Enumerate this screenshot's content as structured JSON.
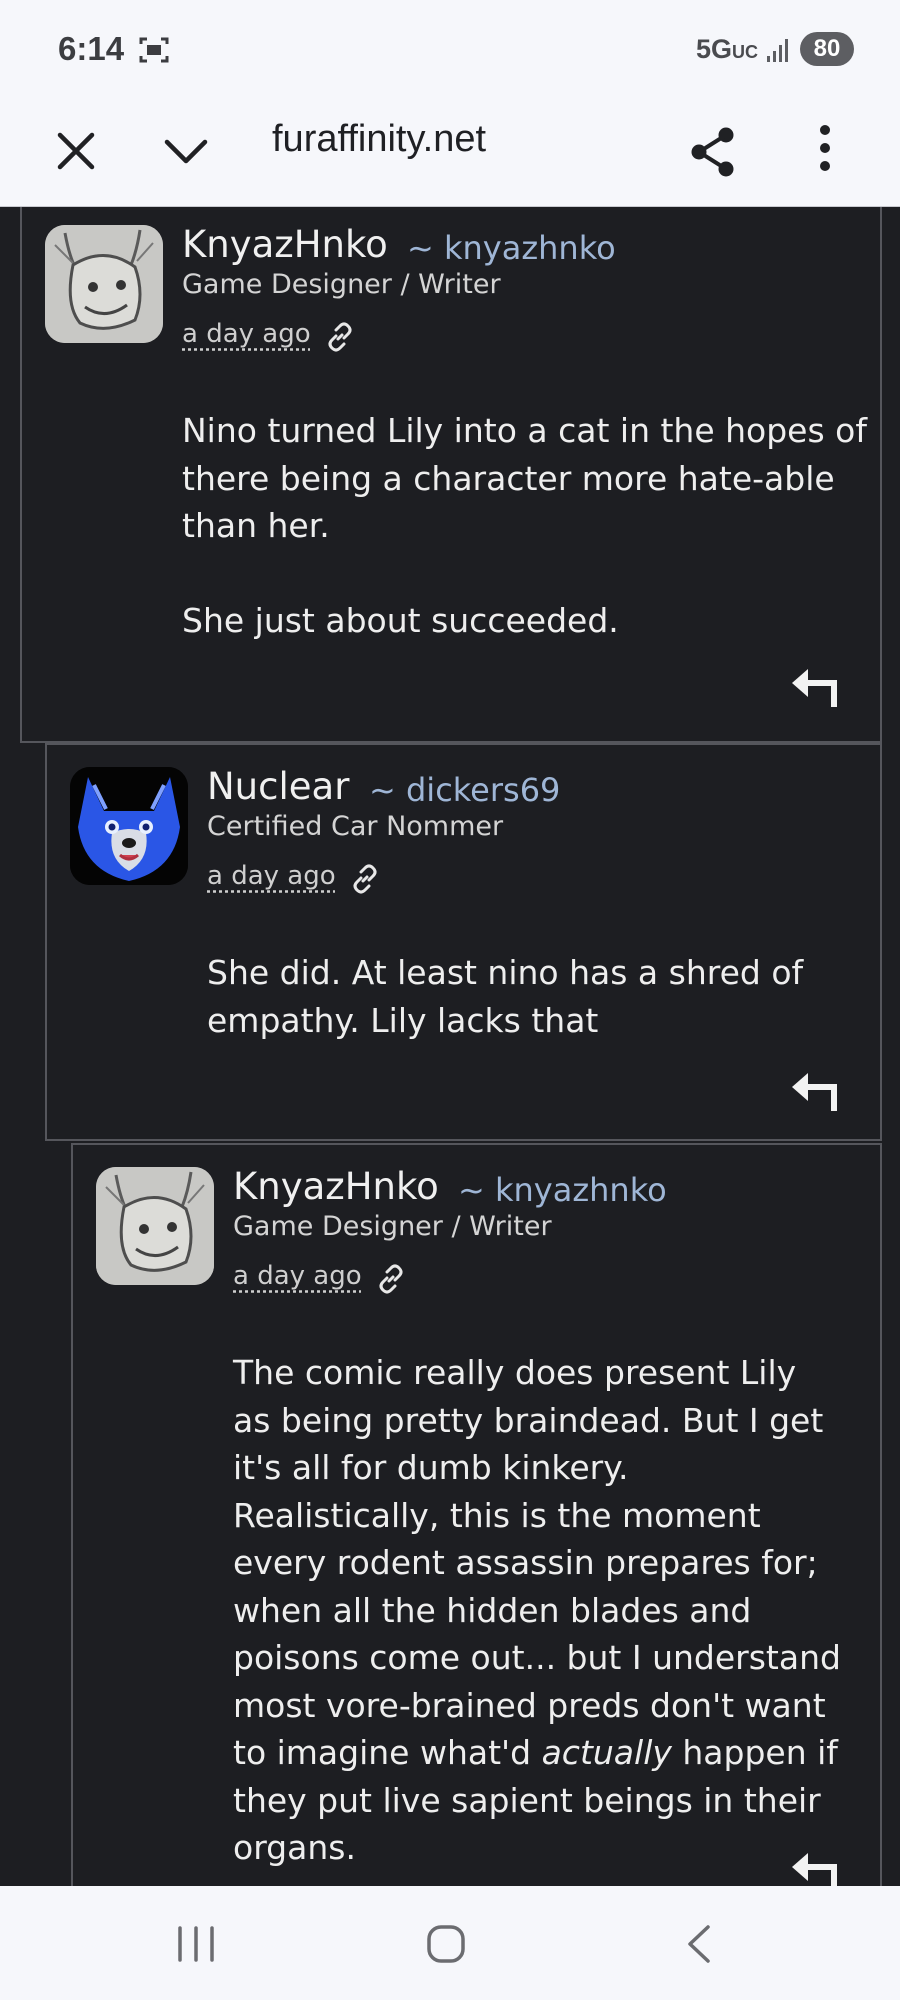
{
  "status_bar": {
    "time": "6:14",
    "network": "5G",
    "network_suffix": "UC",
    "battery": "80"
  },
  "browser": {
    "url": "furaffinity.net"
  },
  "comments": [
    {
      "username": "KnyazHnko",
      "handle": "~ knyazhnko",
      "user_title": "Game Designer / Writer",
      "posted": "a day ago",
      "paragraphs": [
        "Nino turned Lily into a cat in the hopes of there being a character more hate-able than her.",
        "She just about succeeded."
      ]
    },
    {
      "username": "Nuclear",
      "handle": "~ dickers69",
      "user_title": "Certified Car Nommer",
      "posted": "a day ago",
      "paragraphs": [
        "She did. At least nino has a shred of empathy. Lily lacks that"
      ]
    },
    {
      "username": "KnyazHnko",
      "handle": "~ knyazhnko",
      "user_title": "Game Designer / Writer",
      "posted": "a day ago",
      "paragraph_before_emphasis": "The comic really does present Lily as being pretty braindead. But I get it's all for dumb kinkery. Realistically, this is the moment every rodent assassin prepares for; when all the hidden blades and poisons come out... but I understand most vore-brained preds don't want to imagine what'd",
      "emphasis": "actually",
      "paragraph_after_emphasis": "happen if they put live sapient beings in their organs."
    }
  ],
  "colors": {
    "page_background": "#1d1e22",
    "handle": "#9fb6d6",
    "border": "#55565c",
    "chrome": "#f6f7fb"
  }
}
